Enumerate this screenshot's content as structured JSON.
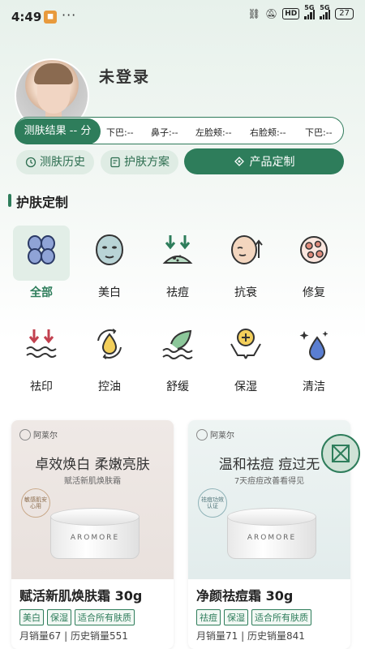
{
  "status_bar": {
    "time": "4:49",
    "network_1": "5G",
    "network_2": "5G",
    "battery": "27"
  },
  "profile": {
    "username": "未登录"
  },
  "scores": {
    "score_label": "测肤结果 -- 分",
    "metrics": [
      {
        "label": "下巴:--"
      },
      {
        "label": "鼻子:--"
      },
      {
        "label": "左脸颊:--"
      },
      {
        "label": "右脸颊:--"
      },
      {
        "label": "下巴:--"
      }
    ]
  },
  "actions": {
    "history": "测肤历史",
    "plan": "护肤方案",
    "customize": "产品定制"
  },
  "section": {
    "title": "护肤定制"
  },
  "categories": [
    {
      "label": "全部",
      "icon": "grid-icon",
      "active": true
    },
    {
      "label": "美白",
      "icon": "face-mask-icon"
    },
    {
      "label": "祛痘",
      "icon": "acne-icon"
    },
    {
      "label": "抗衰",
      "icon": "anti-aging-icon"
    },
    {
      "label": "修复",
      "icon": "repair-icon"
    },
    {
      "label": "祛印",
      "icon": "mark-removal-icon"
    },
    {
      "label": "控油",
      "icon": "oil-control-icon"
    },
    {
      "label": "舒缓",
      "icon": "soothing-icon"
    },
    {
      "label": "保湿",
      "icon": "moisturize-icon"
    },
    {
      "label": "清洁",
      "icon": "cleansing-icon"
    }
  ],
  "products": [
    {
      "brand": "阿莱尔",
      "headline": "卓效焕白  柔嫩亮肤",
      "subline": "赋活新肌焕肤霜",
      "seal": "敏感肌安心用",
      "jar_brand": "AROMORE",
      "name": "赋活新肌焕肤霜 30g",
      "tags": [
        "美白",
        "保湿",
        "适合所有肤质"
      ],
      "sales": "月销量67 | 历史销量551"
    },
    {
      "brand": "阿莱尔",
      "headline": "温和祛痘  痘过无",
      "subline": "7天痘痘改善看得见",
      "seal": "祛痘功效认证",
      "jar_brand": "AROMORE",
      "name": "净颜祛痘霜 30g",
      "tags": [
        "祛痘",
        "保湿",
        "适合所有肤质"
      ],
      "sales": "月销量71 | 历史销量841"
    }
  ],
  "colors": {
    "primary": "#2e7d5b",
    "primary_light": "#dfece4"
  }
}
